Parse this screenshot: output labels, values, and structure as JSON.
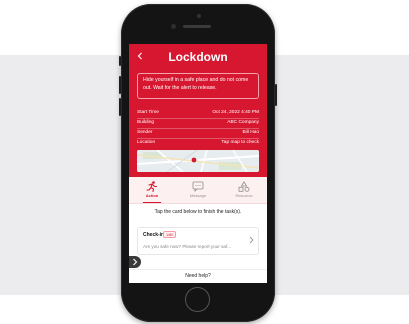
{
  "header": {
    "back_icon": "chevron-left-icon",
    "title": "Lockdown"
  },
  "alert": {
    "message": "Hide yourself in a safe place and do not come out. Wait for the alert to release."
  },
  "info": [
    {
      "key": "Start Time",
      "value": "Oct 24, 2022 4:40 PM"
    },
    {
      "key": "Building",
      "value": "ABC Company"
    },
    {
      "key": "Sender",
      "value": "Bill Hao"
    },
    {
      "key": "Location",
      "value": "Tap map to check"
    }
  ],
  "tabs": [
    {
      "label": "Action",
      "icon": "running-person-icon",
      "active": true
    },
    {
      "label": "Message",
      "icon": "message-icon",
      "active": false
    },
    {
      "label": "Resource",
      "icon": "resource-shapes-icon",
      "active": false
    }
  ],
  "instruction": "Tap the card below to finish the task(s).",
  "task_card": {
    "title": "Check-in",
    "badge": "1/80",
    "prompt": "Are you safe now? Please report your saf...",
    "chevron_icon": "chevron-right-icon"
  },
  "side_tab_icon": "chevron-right-icon",
  "help_text": "Need help?",
  "colors": {
    "accent": "#d7172f",
    "backdrop": "#ececef",
    "phone_body": "#141414"
  }
}
